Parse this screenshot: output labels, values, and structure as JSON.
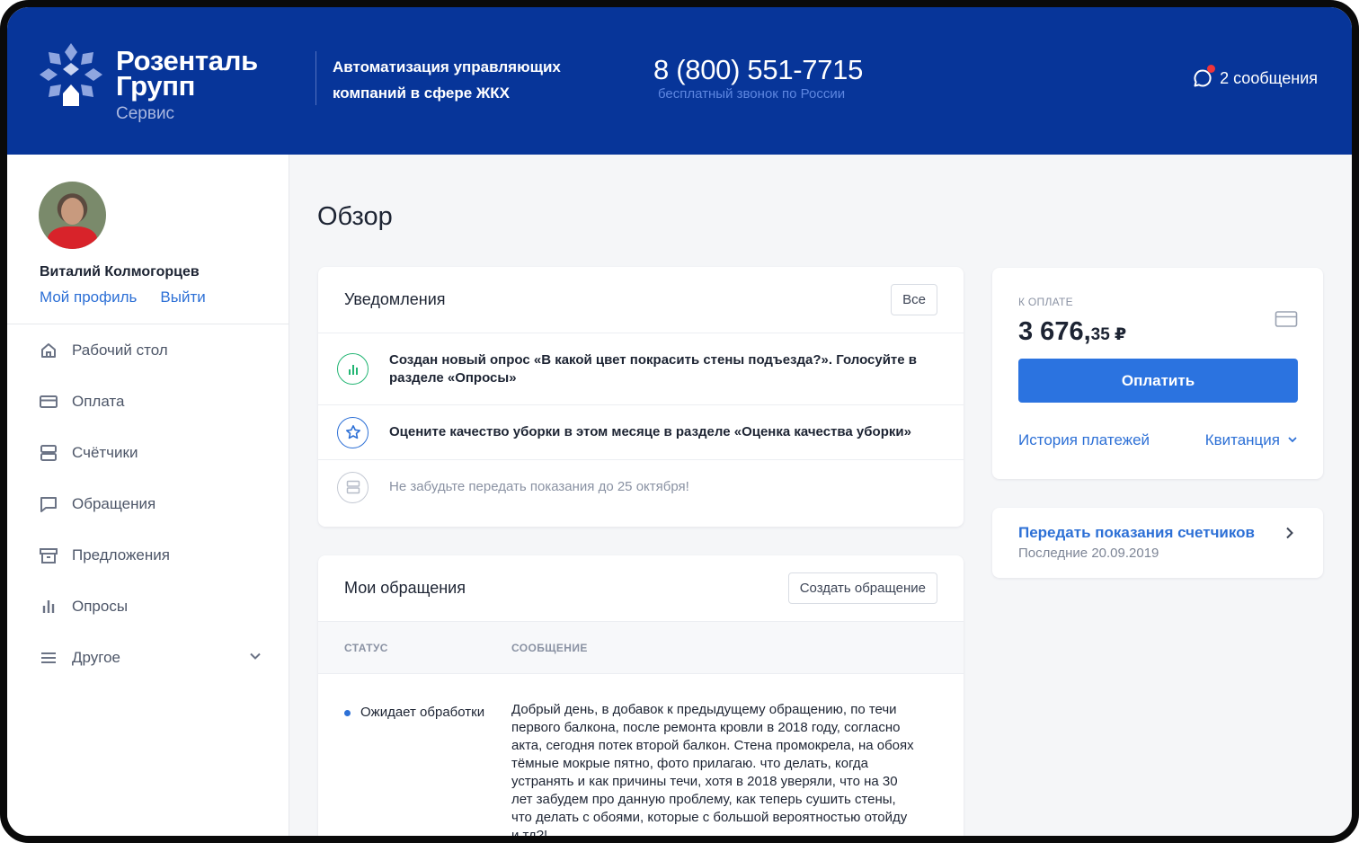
{
  "header": {
    "brand_line1": "Розенталь",
    "brand_line2": "Групп",
    "brand_sub": "Сервис",
    "tagline_line1": "Автоматизация управляющих",
    "tagline_line2": "компаний в сфере ЖКХ",
    "phone": "8 (800) 551-7715",
    "phone_sub": "бесплатный звонок по России",
    "messages": "2 сообщения"
  },
  "user": {
    "name": "Виталий Колмогорцев",
    "profile_link": "Мой профиль",
    "logout_link": "Выйти"
  },
  "sidebar": {
    "items": [
      {
        "label": "Рабочий стол",
        "icon": "home-icon"
      },
      {
        "label": "Оплата",
        "icon": "card-icon"
      },
      {
        "label": "Счётчики",
        "icon": "meter-icon"
      },
      {
        "label": "Обращения",
        "icon": "chat-icon"
      },
      {
        "label": "Предложения",
        "icon": "box-icon"
      },
      {
        "label": "Опросы",
        "icon": "poll-icon"
      },
      {
        "label": "Другое",
        "icon": "menu-icon"
      }
    ]
  },
  "page": {
    "title": "Обзор"
  },
  "notifications": {
    "title": "Уведомления",
    "all_button": "Все",
    "items": [
      {
        "text": "Создан новый опрос «В какой цвет покрасить стены подъезда?». Голосуйте в разделе «Опросы»",
        "icon": "poll-icon"
      },
      {
        "text": "Оцените качество уборки в этом месяце в разделе «Оценка качества уборки»",
        "icon": "star-icon"
      },
      {
        "text": "Не забудьте передать показания до 25 октября!",
        "icon": "meter-icon"
      }
    ]
  },
  "appeals": {
    "title": "Мои обращения",
    "create_button": "Создать обращение",
    "columns": [
      "СТАТУС",
      "СООБЩЕНИЕ"
    ],
    "rows": [
      {
        "status": "Ожидает обработки",
        "message": "Добрый день, в добавок к предыдущему обращению,  по течи первого балкона, после ремонта кровли в 2018 году, согласно акта, сегодня потек второй балкон. Стена промокрела, на обоях тёмные мокрые пятно, фото прилагаю. что делать, когда устранять и как причины течи, хотя в 2018 уверяли, что на 30 лет забудем про данную проблему,  как теперь сушить стены, что делать с обоями, которые с большой вероятностью отойду и тд?!"
      }
    ]
  },
  "payment": {
    "label": "К ОПЛАТЕ",
    "amount_main": "3 676,",
    "amount_cents": "35 ₽",
    "pay_button": "Оплатить",
    "history_link": "История платежей",
    "receipt_link": "Квитанция"
  },
  "meters": {
    "title": "Передать показания счетчиков",
    "subtitle": "Последние 20.09.2019"
  },
  "colors": {
    "header_bg": "#073599",
    "accent": "#2b73e0",
    "link": "#2d70d6",
    "notification_dot": "#f0353b"
  }
}
